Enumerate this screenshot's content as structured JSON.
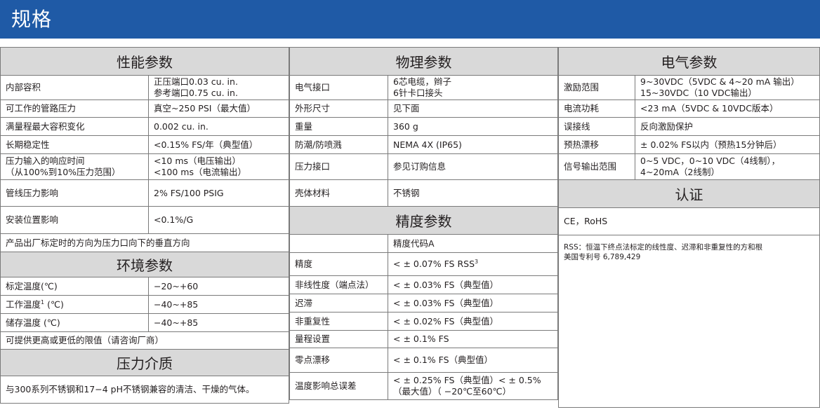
{
  "title": "规格",
  "performance": {
    "header": "性能参数",
    "rows": [
      {
        "label": "内部容积",
        "value": "正压端口0.03 cu. in.\n参考端口0.75 cu. in."
      },
      {
        "label": "可工作的管路压力",
        "value": "真空~250 PSI（最大值）"
      },
      {
        "label": "满量程最大容积变化",
        "value": "0.002 cu. in."
      },
      {
        "label": "长期稳定性",
        "value": "<0.15% FS/年（典型值）"
      },
      {
        "label": "压力输入的响应时间\n（从100%到10%压力范围）",
        "value": "<10 ms（电压输出）\n<100 ms（电流输出）"
      },
      {
        "label": "管线压力影响",
        "value": "2% FS/100 PSIG"
      },
      {
        "label": "安装位置影响",
        "value": "<0.1%/G"
      }
    ],
    "mount_note": "产品出厂标定时的方向为压力口向下的垂直方向"
  },
  "environment": {
    "header": "环境参数",
    "rows": [
      {
        "label": "标定温度(℃)",
        "value": "−20~+60"
      },
      {
        "label": "工作温度",
        "label_sup": "1",
        "label_suffix": " (℃)",
        "value": "−40~+85"
      },
      {
        "label": "储存温度 (℃)",
        "value": "−40~+85"
      }
    ],
    "note": "可提供更高或更低的限值（请咨询厂商）"
  },
  "media": {
    "header": "压力介质",
    "text": "与300系列不锈钢和17−4 pH不锈钢兼容的清洁、干燥的气体。"
  },
  "physical": {
    "header": "物理参数",
    "rows": [
      {
        "label": "电气接口",
        "value": "6芯电缆，辫子\n6针卡口接头"
      },
      {
        "label": "外形尺寸",
        "value": "见下面"
      },
      {
        "label": "重量",
        "value": "360 g"
      },
      {
        "label": "防潮/防喷溅",
        "value": "NEMA 4X (IP65)"
      },
      {
        "label": "压力接口",
        "value": "参见订购信息"
      },
      {
        "label": "壳体材料",
        "value": "不锈钢"
      }
    ]
  },
  "accuracy": {
    "header": "精度参数",
    "code": "精度代码A",
    "rows": [
      {
        "label": "精度",
        "value": "< ± 0.07% FS RSS",
        "value_sup": "3"
      },
      {
        "label": "非线性度（端点法）",
        "value": "< ± 0.03% FS（典型值）"
      },
      {
        "label": "迟滞",
        "value": "< ± 0.03% FS（典型值）"
      },
      {
        "label": "非重复性",
        "value": "< ± 0.02% FS（典型值）"
      },
      {
        "label": "量程设置",
        "value": "< ± 0.1% FS"
      },
      {
        "label": "零点漂移",
        "value": "< ± 0.1% FS（典型值）"
      },
      {
        "label": "温度影响总误差",
        "value": "< ± 0.25% FS（典型值）< ± 0.5%\n（最大值）（ −20℃至60℃）"
      }
    ]
  },
  "electrical": {
    "header": "电气参数",
    "rows": [
      {
        "label": "激励范围",
        "value": "9~30VDC（5VDC & 4~20 mA 输出）\n15~30VDC（10 VDC输出）"
      },
      {
        "label": "电流功耗",
        "value": "<23 mA（5VDC & 10VDC版本）"
      },
      {
        "label": "误接线",
        "value": "反向激励保护"
      },
      {
        "label": "预热漂移",
        "value": "± 0.02% FS以内（预热15分钟后）"
      },
      {
        "label": "信号输出范围",
        "value": "0~5 VDC，0~10 VDC（4线制），\n4~20mA（2线制）"
      }
    ]
  },
  "certification": {
    "header": "认证",
    "value": "CE，RoHS",
    "footnote": "RSS：恒温下终点法标定的线性度、迟滞和非重复性的方和根\n美国专利号 6,789,429"
  }
}
